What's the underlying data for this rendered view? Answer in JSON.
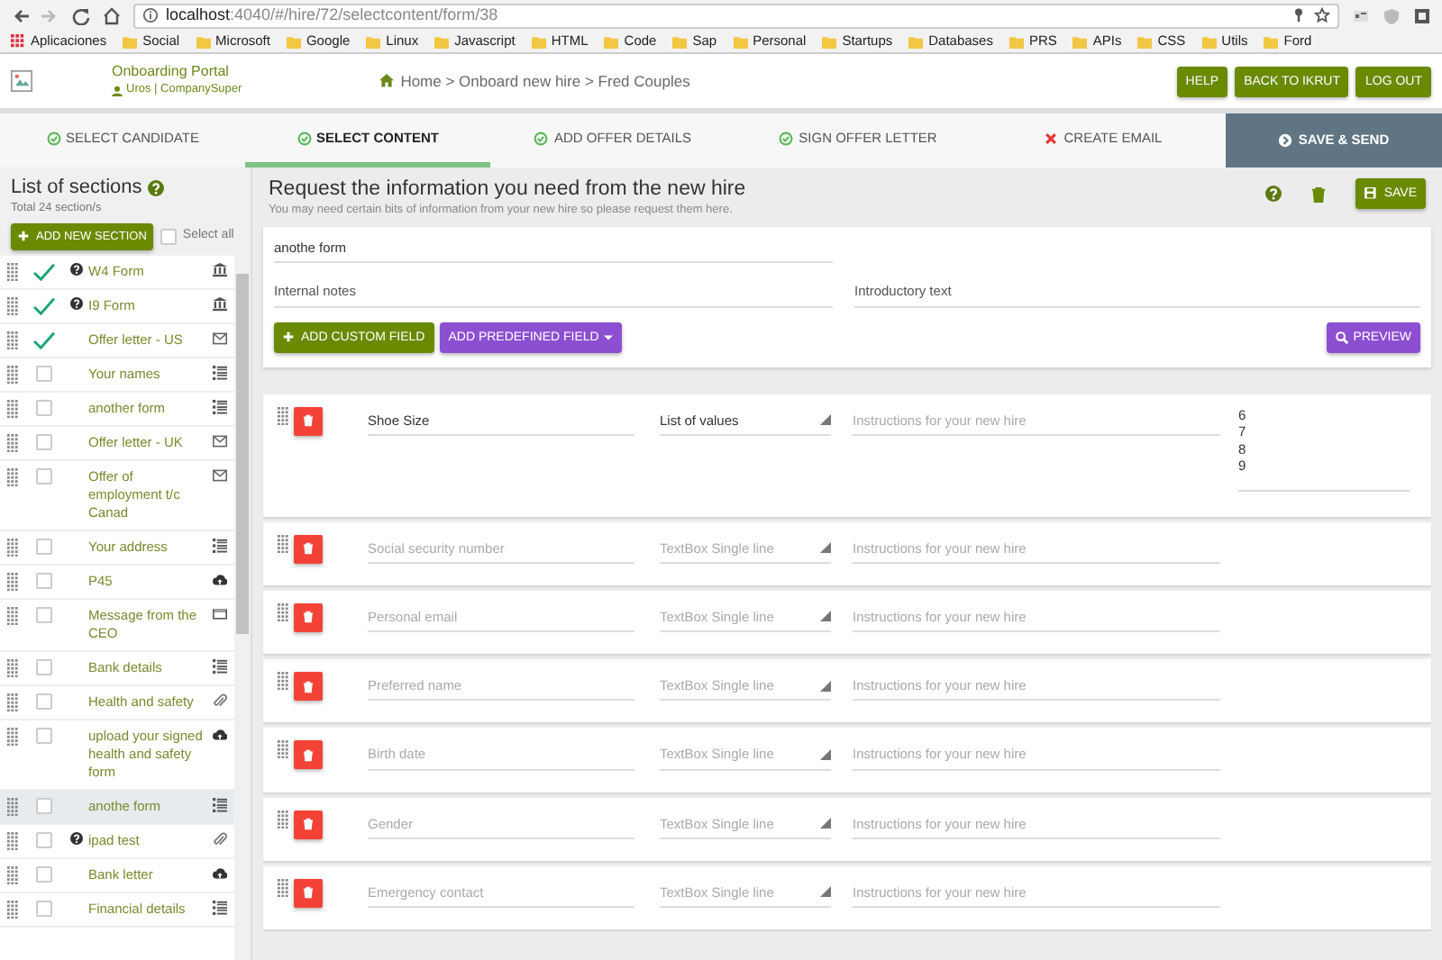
{
  "browser": {
    "url_host": "localhost",
    "url_rest": ":4040/#/hire/72/selectcontent/form/38",
    "bookmarks": [
      {
        "label": "Aplicaciones",
        "kind": "apps"
      },
      {
        "label": "Social",
        "kind": "folder"
      },
      {
        "label": "Microsoft",
        "kind": "folder"
      },
      {
        "label": "Google",
        "kind": "folder"
      },
      {
        "label": "Linux",
        "kind": "folder"
      },
      {
        "label": "Javascript",
        "kind": "folder"
      },
      {
        "label": "HTML",
        "kind": "folder"
      },
      {
        "label": "Code",
        "kind": "folder"
      },
      {
        "label": "Sap",
        "kind": "folder"
      },
      {
        "label": "Personal",
        "kind": "folder"
      },
      {
        "label": "Startups",
        "kind": "folder"
      },
      {
        "label": "Databases",
        "kind": "folder"
      },
      {
        "label": "PRS",
        "kind": "folder"
      },
      {
        "label": "APIs",
        "kind": "folder"
      },
      {
        "label": "CSS",
        "kind": "folder"
      },
      {
        "label": "Utils",
        "kind": "folder"
      },
      {
        "label": "Ford",
        "kind": "folder"
      }
    ]
  },
  "header": {
    "title": "Onboarding Portal",
    "user": "Uros | CompanySuper",
    "breadcrumb": "Home > Onboard new hire > Fred Couples",
    "buttons": [
      "HELP",
      "BACK TO IKRUT",
      "LOG OUT"
    ]
  },
  "steps": [
    {
      "label": "SELECT CANDIDATE",
      "complete": true,
      "selected": false
    },
    {
      "label": "SELECT CONTENT",
      "complete": true,
      "selected": true
    },
    {
      "label": "ADD OFFER DETAILS",
      "complete": true,
      "selected": false
    },
    {
      "label": "SIGN OFFER LETTER",
      "complete": true,
      "selected": false
    },
    {
      "label": "CREATE EMAIL",
      "complete": false,
      "selected": false
    }
  ],
  "save_send": "SAVE & SEND",
  "sidebar": {
    "title": "List of sections",
    "total": "Total 24 section/s",
    "add_button": "ADD NEW SECTION",
    "select_all": {
      "label": "Select all",
      "checked": false
    },
    "items": [
      {
        "name": "W4 Form",
        "done": true,
        "help": true,
        "kind": "bank",
        "selected": false
      },
      {
        "name": "I9 Form",
        "done": true,
        "help": true,
        "kind": "bank",
        "selected": false
      },
      {
        "name": "Offer letter - US",
        "done": true,
        "help": false,
        "kind": "mail",
        "selected": false
      },
      {
        "name": "Your names",
        "done": false,
        "help": false,
        "kind": "list",
        "selected": false
      },
      {
        "name": "another form",
        "done": false,
        "help": false,
        "kind": "list",
        "selected": false
      },
      {
        "name": "Offer letter - UK",
        "done": false,
        "help": false,
        "kind": "mail",
        "selected": false
      },
      {
        "name": "Offer of employment t/c Canad",
        "done": false,
        "help": false,
        "kind": "mail",
        "selected": false
      },
      {
        "name": "Your address",
        "done": false,
        "help": false,
        "kind": "list",
        "selected": false
      },
      {
        "name": "P45",
        "done": false,
        "help": false,
        "kind": "upload",
        "selected": false
      },
      {
        "name": "Message from the CEO",
        "done": false,
        "help": false,
        "kind": "video",
        "selected": false
      },
      {
        "name": "Bank details",
        "done": false,
        "help": false,
        "kind": "list",
        "selected": false
      },
      {
        "name": "Health and safety",
        "done": false,
        "help": false,
        "kind": "attach",
        "selected": false
      },
      {
        "name": "upload your signed health and safety form",
        "done": false,
        "help": false,
        "kind": "upload",
        "selected": false
      },
      {
        "name": "anothe form",
        "done": false,
        "help": false,
        "kind": "list",
        "selected": true
      },
      {
        "name": "ipad test",
        "done": false,
        "help": true,
        "kind": "attach",
        "selected": false
      },
      {
        "name": "Bank letter",
        "done": false,
        "help": false,
        "kind": "upload",
        "selected": false
      },
      {
        "name": "Financial details",
        "done": false,
        "help": false,
        "kind": "list",
        "selected": false
      }
    ]
  },
  "main": {
    "title": "Request the information you need from the new hire",
    "subtitle": "You may need certain bits of information from your new hire so please request them here.",
    "save": "SAVE",
    "form_name": "anothe form",
    "internal_notes": {
      "placeholder": "Internal notes"
    },
    "intro_text": {
      "placeholder": "Introductory text"
    },
    "add_custom": "ADD CUSTOM FIELD",
    "add_predefined": "ADD PREDEFINED FIELD",
    "preview": "PREVIEW",
    "fields": [
      {
        "name": "Shoe Size",
        "type": "List of values",
        "instructions": {
          "placeholder": "Instructions for your new hire"
        },
        "options": [
          "6",
          "7",
          "8",
          "9"
        ]
      },
      {
        "name": {
          "placeholder": "Social security number"
        },
        "type": "TextBox Single line",
        "instructions": {
          "placeholder": "Instructions for your new hire"
        }
      },
      {
        "name": {
          "placeholder": "Personal email"
        },
        "type": "TextBox Single line",
        "instructions": {
          "placeholder": "Instructions for your new hire"
        }
      },
      {
        "name": {
          "placeholder": "Preferred name"
        },
        "type": "TextBox Single line",
        "instructions": {
          "placeholder": "Instructions for your new hire"
        }
      },
      {
        "name": {
          "placeholder": "Birth date"
        },
        "type": "TextBox Single line",
        "instructions": {
          "placeholder": "Instructions for your new hire"
        }
      },
      {
        "name": {
          "placeholder": "Gender"
        },
        "type": "TextBox Single line",
        "instructions": {
          "placeholder": "Instructions for your new hire"
        }
      },
      {
        "name": {
          "placeholder": "Emergency contact"
        },
        "type": "TextBox Single line",
        "instructions": {
          "placeholder": "Instructions for your new hire"
        }
      }
    ]
  }
}
